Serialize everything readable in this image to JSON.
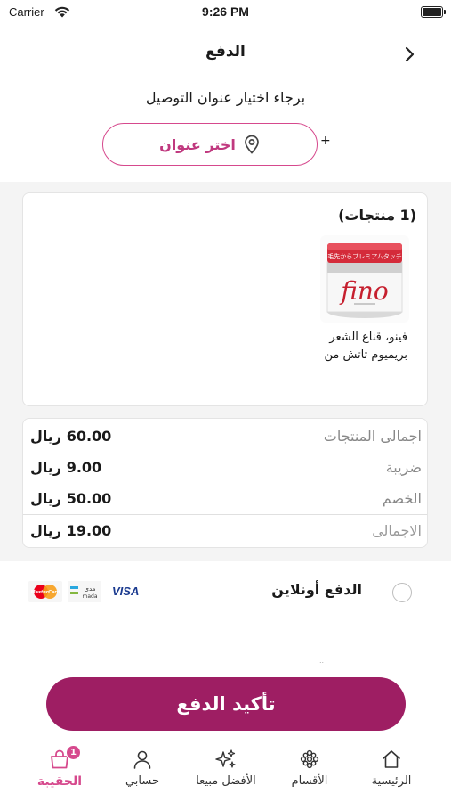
{
  "status_bar": {
    "carrier": "Carrier",
    "time": "9:26 PM"
  },
  "header": {
    "title": "الدفع",
    "back_icon": "chevron-right-icon"
  },
  "address": {
    "prompt": "برجاء اختيار عنوان التوصيل",
    "button_label": "اختر عنوان",
    "plus": "+"
  },
  "products": {
    "title": "(1 منتجات)",
    "items": [
      {
        "name": "فينو، قناع الشعر بريميوم تاتش من",
        "image_brand": "fino",
        "image_banner": "毛先からプレミアムタッチ"
      }
    ]
  },
  "summary": {
    "rows": [
      {
        "label": "اجمالى المنتجات",
        "value": "60.00 ريال"
      },
      {
        "label": "ضريبة",
        "value": "9.00 ريال"
      },
      {
        "label": "الخصم",
        "value": "50.00 ريال"
      },
      {
        "label": "الاجمالى",
        "value": "19.00 ريال"
      }
    ]
  },
  "payment": {
    "online_label": "الدفع أونلاين",
    "selected": false,
    "cards": [
      "VISA",
      "مدى",
      "mada",
      "MasterCard"
    ]
  },
  "confirm_button": {
    "label": "تأكيد الدفع"
  },
  "tabs": [
    {
      "label": "الرئيسية",
      "icon": "home-icon",
      "active": false
    },
    {
      "label": "الأقسام",
      "icon": "categories-icon",
      "active": false
    },
    {
      "label": "الأفضل مبيعا",
      "icon": "sparkle-icon",
      "active": false
    },
    {
      "label": "حسابي",
      "icon": "user-icon",
      "active": false
    },
    {
      "label": "الحقيبة",
      "icon": "bag-icon",
      "active": true,
      "badge": "1"
    }
  ],
  "colors": {
    "accent": "#d6498d",
    "confirm": "#9e1e63",
    "background": "#f4f4f4"
  }
}
